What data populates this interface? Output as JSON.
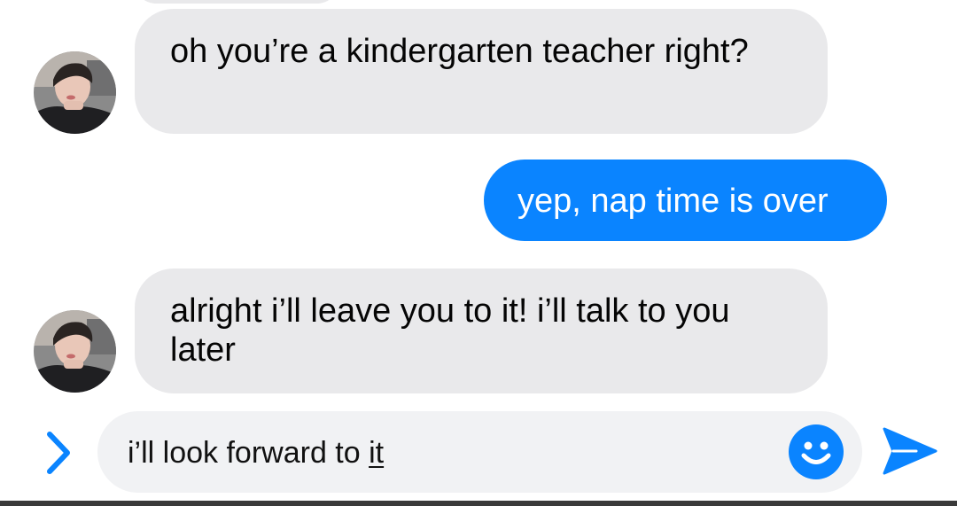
{
  "conversation": {
    "messages": [
      {
        "sender": "contact",
        "text": "oh you’re a kindergarten teacher right?"
      },
      {
        "sender": "me",
        "text": "yep, nap time is over"
      },
      {
        "sender": "contact",
        "text": "alright i’ll leave you to it! i’ll talk to you later"
      }
    ]
  },
  "composer": {
    "draft_text_start": "i’ll look forward to ",
    "draft_text_underlined": "it",
    "expand_icon": "chevron-right-icon",
    "emoji_icon": "smiley-icon",
    "send_icon": "send-arrow-icon"
  },
  "colors": {
    "outgoing_bubble": "#0a84ff",
    "incoming_bubble": "#e9e9eb",
    "accent": "#0a84ff",
    "composer_background": "#f1f2f4"
  }
}
